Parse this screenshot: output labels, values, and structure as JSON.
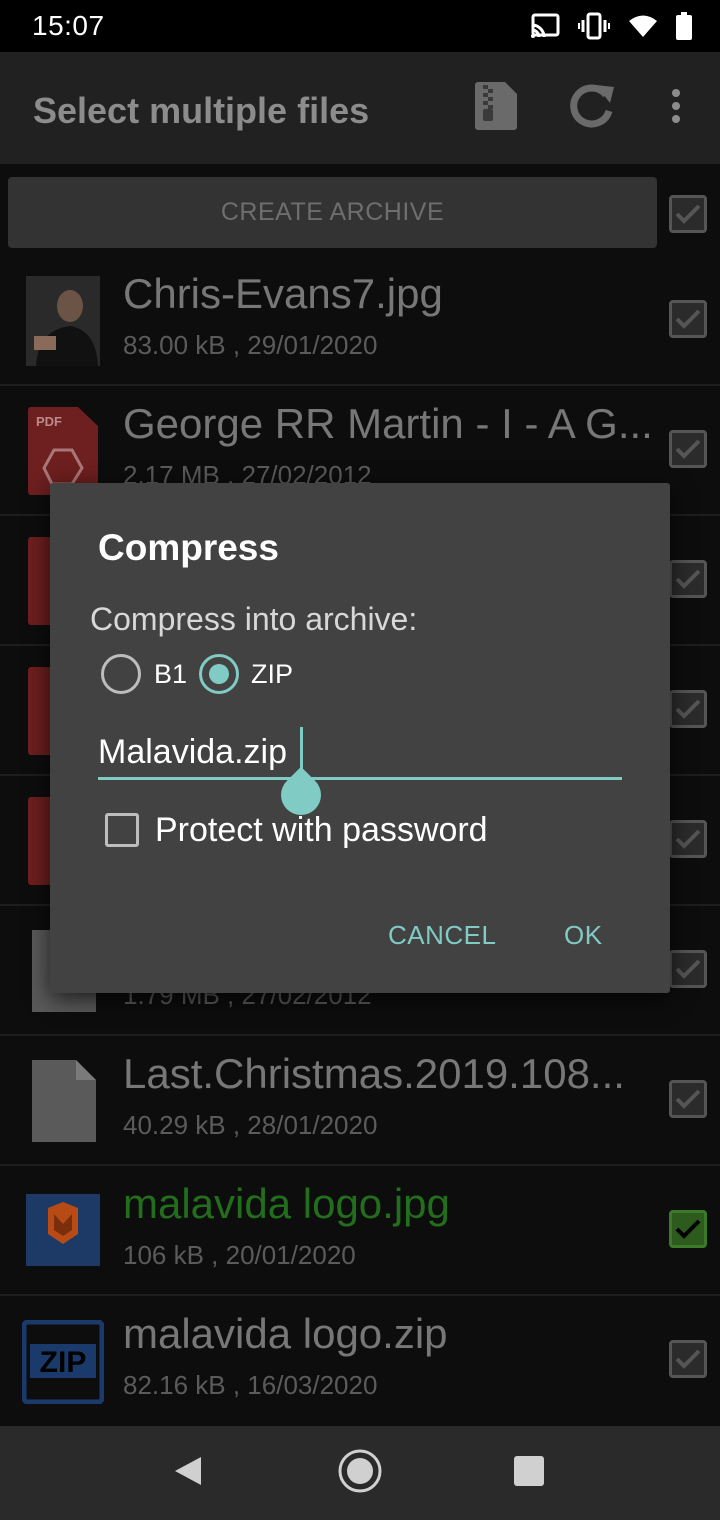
{
  "status_bar": {
    "time": "15:07",
    "icons": [
      "cast-icon",
      "vibrate-icon",
      "wifi-icon",
      "battery-icon"
    ]
  },
  "app_bar": {
    "title": "Select multiple files",
    "actions": [
      "archive-icon",
      "refresh-icon",
      "more-vert-icon"
    ]
  },
  "list": {
    "create_archive_label": "CREATE ARCHIVE",
    "items": [
      {
        "name": "Chris-Evans7.jpg",
        "meta": "83.00 kB , 29/01/2020",
        "thumb": "photo",
        "checked": false
      },
      {
        "name": "George RR Martin - I - A G...",
        "meta": "2.17 MB , 27/02/2012",
        "thumb": "pdf",
        "checked": false
      },
      {
        "name": "",
        "meta": "",
        "thumb": "pdf",
        "checked": false
      },
      {
        "name": "",
        "meta": "",
        "thumb": "pdf",
        "checked": false
      },
      {
        "name": "",
        "meta": "",
        "thumb": "pdf",
        "checked": false
      },
      {
        "name": "",
        "meta": "1.79 MB , 27/02/2012",
        "thumb": "file",
        "checked": false
      },
      {
        "name": "Last.Christmas.2019.108...",
        "meta": "40.29 kB , 28/01/2020",
        "thumb": "file",
        "checked": false
      },
      {
        "name": "malavida logo.jpg",
        "meta": "106 kB , 20/01/2020",
        "thumb": "malavida",
        "checked": true
      },
      {
        "name": "malavida logo.zip",
        "meta": "82.16 kB , 16/03/2020",
        "thumb": "zip",
        "checked": false
      }
    ]
  },
  "dialog": {
    "title": "Compress",
    "label": "Compress into archive:",
    "options": [
      "B1",
      "ZIP"
    ],
    "selected_option": "ZIP",
    "filename_value": "Malavida.zip",
    "password_label": "Protect with password",
    "password_checked": false,
    "cancel_label": "CANCEL",
    "ok_label": "OK"
  },
  "colors": {
    "accent": "#80cbc4",
    "dialog_bg": "#424242",
    "selected_green": "#236e1c"
  },
  "nav_bar": {
    "buttons": [
      "back-icon",
      "home-icon",
      "recents-icon"
    ]
  }
}
